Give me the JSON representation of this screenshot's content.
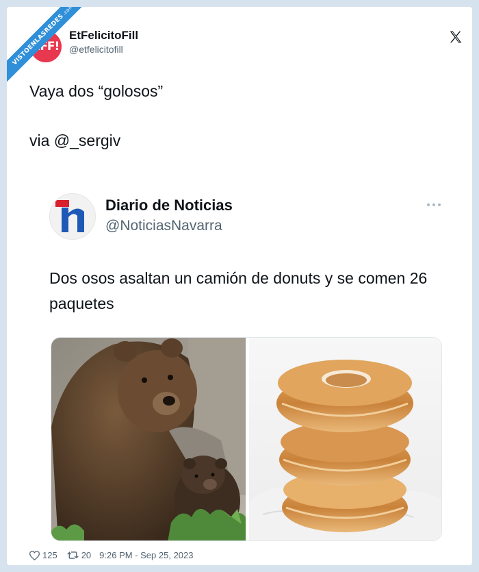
{
  "watermark": {
    "text": "VISTOENLASREDES",
    "suffix": ".com"
  },
  "author": {
    "name": "EtFelicitoFill",
    "handle": "@etfelicitofill",
    "avatar_text": "EFF!",
    "avatar_color": "#e8384f"
  },
  "tweet": {
    "text": "Vaya dos “golosos”",
    "via": "via @_sergiv"
  },
  "quoted": {
    "name": "Diario de Noticias",
    "handle": "@NoticiasNavarra",
    "text": "Dos osos asaltan un camión de donuts y se comen 26 paquetes",
    "logo_colors": {
      "red": "#d8202f",
      "blue": "#1f59b8"
    }
  },
  "media": {
    "left_image": "bear-photo",
    "right_image": "donuts-photo"
  },
  "footer": {
    "likes": "125",
    "retweets": "20",
    "timestamp": "9:26 PM - Sep 25, 2023"
  },
  "colors": {
    "page_bg": "#d6e3ef",
    "text": "#0f1419",
    "secondary_text": "#536471",
    "watermark_blue": "#2f8fd8"
  }
}
